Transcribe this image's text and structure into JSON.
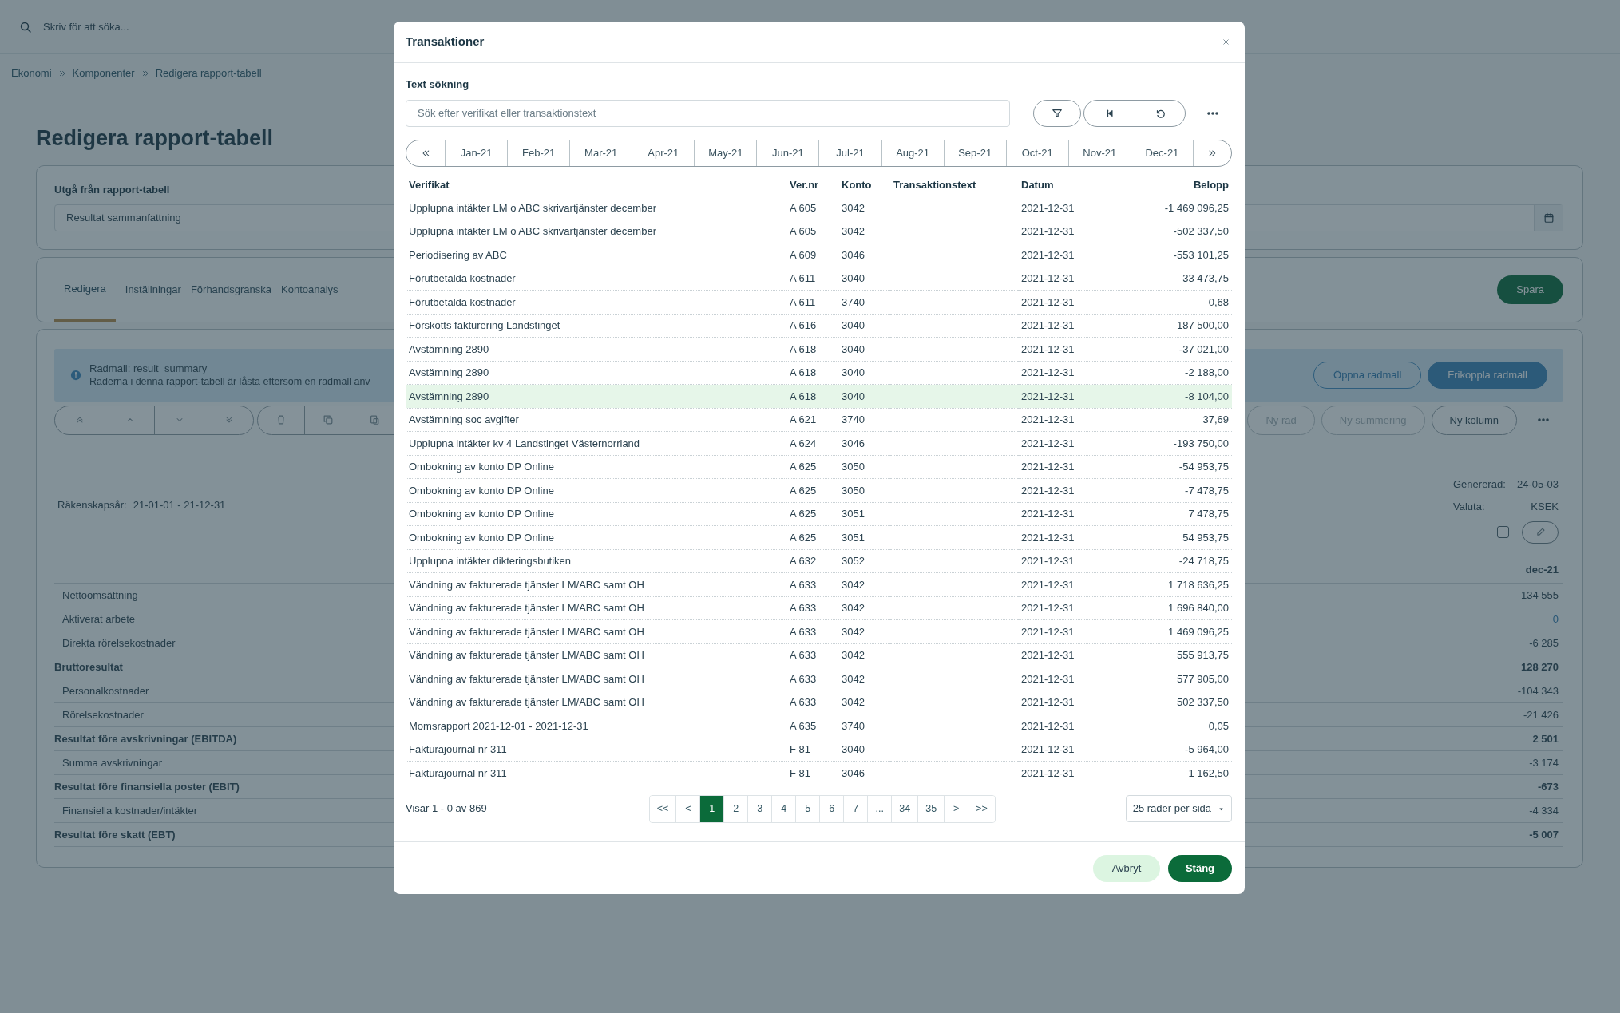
{
  "search": {
    "placeholder": "Skriv för att söka..."
  },
  "breadcrumb": [
    "Ekonomi",
    "Komponenter",
    "Redigera rapport-tabell"
  ],
  "page_title": "Redigera rapport-tabell",
  "source": {
    "label": "Utgå från rapport-tabell",
    "value": "Resultat sammanfattning"
  },
  "tabs": [
    {
      "label": "Redigera",
      "selected": true
    },
    {
      "label": "Inställningar",
      "selected": false
    },
    {
      "label": "Förhandsgranska",
      "selected": false
    },
    {
      "label": "Kontoanalys",
      "selected": false
    }
  ],
  "save_button": "Spara",
  "alert": {
    "title": "Radmall: result_summary",
    "text": "Raderna i denna rapport-tabell är låsta eftersom en radmall anv",
    "buttons": [
      {
        "label": "Öppna radmall",
        "kind": "outline"
      },
      {
        "label": "Frikoppla radmall",
        "kind": "filled"
      }
    ]
  },
  "actions": [
    {
      "label": "Ny rad",
      "disabled": true
    },
    {
      "label": "Ny summering",
      "disabled": true
    },
    {
      "label": "Ny kolumn",
      "disabled": false
    }
  ],
  "report": {
    "fiscal_year_label": "Räkenskapsår:",
    "fiscal_year": "21-01-01 - 21-12-31",
    "generated_label": "Genererad:",
    "generated": "24-05-03",
    "currency_label": "Valuta:",
    "currency": "KSEK",
    "checked": false,
    "column": "dec-21",
    "rows": [
      {
        "label": "Nettoomsättning",
        "value": "134 555",
        "kind": "item",
        "link": false
      },
      {
        "label": "Aktiverat arbete",
        "value": "0",
        "kind": "item",
        "link": true
      },
      {
        "label": "Direkta rörelsekostnader",
        "value": "-6 285",
        "kind": "item",
        "link": false
      },
      {
        "label": "Bruttoresultat",
        "value": "128 270",
        "kind": "total",
        "link": false
      },
      {
        "label": "Personalkostnader",
        "value": "-104 343",
        "kind": "item",
        "link": false
      },
      {
        "label": "Rörelsekostnader",
        "value": "-21 426",
        "kind": "item",
        "link": false
      },
      {
        "label": "Resultat före avskrivningar (EBITDA)",
        "value": "2 501",
        "kind": "total",
        "link": false
      },
      {
        "label": "Summa avskrivningar",
        "value": "-3 174",
        "kind": "item",
        "link": false
      },
      {
        "label": "Resultat före finansiella poster (EBIT)",
        "value": "-673",
        "kind": "total",
        "link": false
      },
      {
        "label": "Finansiella kostnader/intäkter",
        "value": "-4 334",
        "kind": "item",
        "link": false
      },
      {
        "label": "Resultat före skatt (EBT)",
        "value": "-5 007",
        "kind": "total",
        "link": false
      }
    ]
  },
  "modal": {
    "title": "Transaktioner",
    "search_label": "Text sökning",
    "search": {
      "placeholder": "Sök efter verifikat eller transaktionstext"
    },
    "months": [
      "Jan-21",
      "Feb-21",
      "Mar-21",
      "Apr-21",
      "May-21",
      "Jun-21",
      "Jul-21",
      "Aug-21",
      "Sep-21",
      "Oct-21",
      "Nov-21",
      "Dec-21"
    ],
    "columns": [
      "Verifikat",
      "Ver.nr",
      "Konto",
      "Transaktionstext",
      "Datum",
      "Belopp"
    ],
    "rows": [
      {
        "verifikat": "Upplupna intäkter LM o ABC skrivartjänster december",
        "ver_nr": "A 605",
        "konto": "3042",
        "datum": "2021-12-31",
        "belopp": "-1 469 096,25",
        "highlighted": false
      },
      {
        "verifikat": "Upplupna intäkter LM o ABC skrivartjänster december",
        "ver_nr": "A 605",
        "konto": "3042",
        "datum": "2021-12-31",
        "belopp": "-502 337,50",
        "highlighted": false
      },
      {
        "verifikat": "Periodisering av ABC",
        "ver_nr": "A 609",
        "konto": "3046",
        "datum": "2021-12-31",
        "belopp": "-553 101,25",
        "highlighted": false
      },
      {
        "verifikat": "Förutbetalda kostnader",
        "ver_nr": "A 611",
        "konto": "3040",
        "datum": "2021-12-31",
        "belopp": "33 473,75",
        "highlighted": false
      },
      {
        "verifikat": "Förutbetalda kostnader",
        "ver_nr": "A 611",
        "konto": "3740",
        "datum": "2021-12-31",
        "belopp": "0,68",
        "highlighted": false
      },
      {
        "verifikat": "Förskotts fakturering Landstinget",
        "ver_nr": "A 616",
        "konto": "3040",
        "datum": "2021-12-31",
        "belopp": "187 500,00",
        "highlighted": false
      },
      {
        "verifikat": "Avstämning 2890",
        "ver_nr": "A 618",
        "konto": "3040",
        "datum": "2021-12-31",
        "belopp": "-37 021,00",
        "highlighted": false
      },
      {
        "verifikat": "Avstämning 2890",
        "ver_nr": "A 618",
        "konto": "3040",
        "datum": "2021-12-31",
        "belopp": "-2 188,00",
        "highlighted": false
      },
      {
        "verifikat": "Avstämning 2890",
        "ver_nr": "A 618",
        "konto": "3040",
        "datum": "2021-12-31",
        "belopp": "-8 104,00",
        "highlighted": true
      },
      {
        "verifikat": "Avstämning soc avgifter",
        "ver_nr": "A 621",
        "konto": "3740",
        "datum": "2021-12-31",
        "belopp": "37,69",
        "highlighted": false
      },
      {
        "verifikat": "Upplupna intäkter kv 4 Landstinget Västernorrland",
        "ver_nr": "A 624",
        "konto": "3046",
        "datum": "2021-12-31",
        "belopp": "-193 750,00",
        "highlighted": false
      },
      {
        "verifikat": "Ombokning av konto DP Online",
        "ver_nr": "A 625",
        "konto": "3050",
        "datum": "2021-12-31",
        "belopp": "-54 953,75",
        "highlighted": false
      },
      {
        "verifikat": "Ombokning av konto DP Online",
        "ver_nr": "A 625",
        "konto": "3050",
        "datum": "2021-12-31",
        "belopp": "-7 478,75",
        "highlighted": false
      },
      {
        "verifikat": "Ombokning av konto DP Online",
        "ver_nr": "A 625",
        "konto": "3051",
        "datum": "2021-12-31",
        "belopp": "7 478,75",
        "highlighted": false
      },
      {
        "verifikat": "Ombokning av konto DP Online",
        "ver_nr": "A 625",
        "konto": "3051",
        "datum": "2021-12-31",
        "belopp": "54 953,75",
        "highlighted": false
      },
      {
        "verifikat": "Upplupna intäkter dikteringsbutiken",
        "ver_nr": "A 632",
        "konto": "3052",
        "datum": "2021-12-31",
        "belopp": "-24 718,75",
        "highlighted": false
      },
      {
        "verifikat": "Vändning av fakturerade tjänster LM/ABC samt OH",
        "ver_nr": "A 633",
        "konto": "3042",
        "datum": "2021-12-31",
        "belopp": "1 718 636,25",
        "highlighted": false
      },
      {
        "verifikat": "Vändning av fakturerade tjänster LM/ABC samt OH",
        "ver_nr": "A 633",
        "konto": "3042",
        "datum": "2021-12-31",
        "belopp": "1 696 840,00",
        "highlighted": false
      },
      {
        "verifikat": "Vändning av fakturerade tjänster LM/ABC samt OH",
        "ver_nr": "A 633",
        "konto": "3042",
        "datum": "2021-12-31",
        "belopp": "1 469 096,25",
        "highlighted": false
      },
      {
        "verifikat": "Vändning av fakturerade tjänster LM/ABC samt OH",
        "ver_nr": "A 633",
        "konto": "3042",
        "datum": "2021-12-31",
        "belopp": "555 913,75",
        "highlighted": false
      },
      {
        "verifikat": "Vändning av fakturerade tjänster LM/ABC samt OH",
        "ver_nr": "A 633",
        "konto": "3042",
        "datum": "2021-12-31",
        "belopp": "577 905,00",
        "highlighted": false
      },
      {
        "verifikat": "Vändning av fakturerade tjänster LM/ABC samt OH",
        "ver_nr": "A 633",
        "konto": "3042",
        "datum": "2021-12-31",
        "belopp": "502 337,50",
        "highlighted": false
      },
      {
        "verifikat": "Momsrapport 2021-12-01 - 2021-12-31",
        "ver_nr": "A 635",
        "konto": "3740",
        "datum": "2021-12-31",
        "belopp": "0,05",
        "highlighted": false
      },
      {
        "verifikat": "Fakturajournal nr 311",
        "ver_nr": "F 81",
        "konto": "3040",
        "datum": "2021-12-31",
        "belopp": "-5 964,00",
        "highlighted": false
      },
      {
        "verifikat": "Fakturajournal nr 311",
        "ver_nr": "F 81",
        "konto": "3046",
        "datum": "2021-12-31",
        "belopp": "1 162,50",
        "highlighted": false
      }
    ],
    "summary": "Visar 1 - 0 av 869",
    "pages": [
      {
        "label": "<<",
        "selected": false
      },
      {
        "label": "<",
        "selected": false
      },
      {
        "label": "1",
        "selected": true
      },
      {
        "label": "2",
        "selected": false
      },
      {
        "label": "3",
        "selected": false
      },
      {
        "label": "4",
        "selected": false
      },
      {
        "label": "5",
        "selected": false
      },
      {
        "label": "6",
        "selected": false
      },
      {
        "label": "7",
        "selected": false
      },
      {
        "label": "...",
        "selected": false
      },
      {
        "label": "34",
        "selected": false
      },
      {
        "label": "35",
        "selected": false
      },
      {
        "label": ">",
        "selected": false
      },
      {
        "label": ">>",
        "selected": false
      }
    ],
    "page_size": "25 rader per sida",
    "buttons": [
      {
        "label": "Avbryt",
        "kind": "secondary"
      },
      {
        "label": "Stäng",
        "kind": "primary"
      }
    ]
  }
}
